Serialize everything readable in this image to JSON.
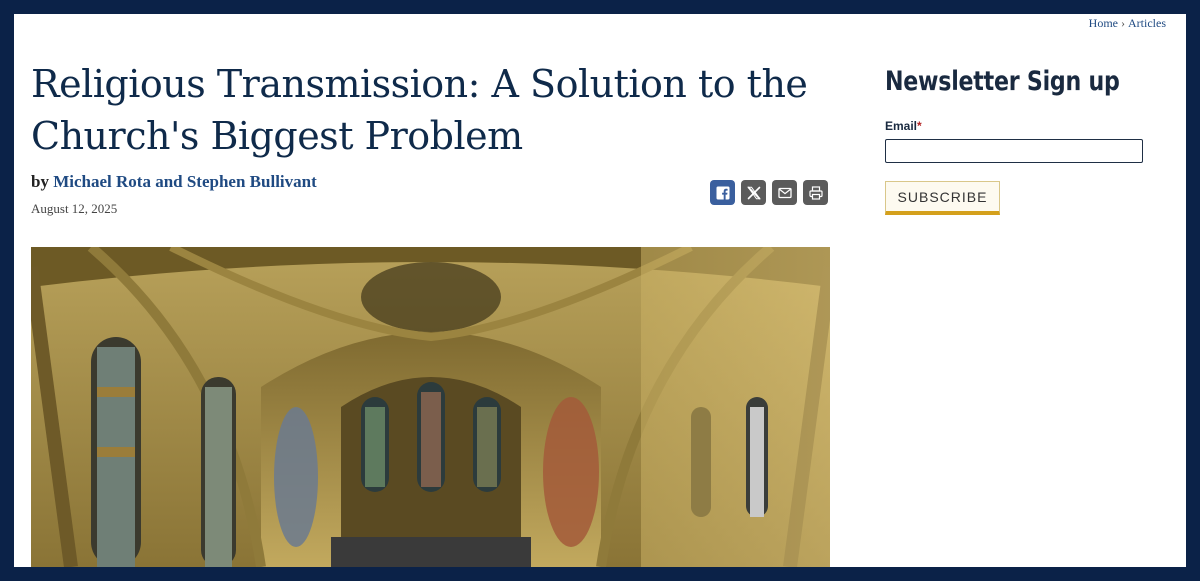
{
  "breadcrumb": {
    "home": "Home",
    "separator": "›",
    "current": "Articles"
  },
  "article": {
    "title": "Religious Transmission: A Solution to the Church's Biggest Problem",
    "by_prefix": "by",
    "authors": "Michael Rota and Stephen Bullivant",
    "date": "August 12, 2025"
  },
  "share": {
    "icons": [
      "facebook-icon",
      "x-icon",
      "email-icon",
      "print-icon"
    ]
  },
  "sidebar": {
    "title": "Newsletter Sign up",
    "email_label": "Email",
    "required_mark": "*",
    "email_value": "",
    "subscribe_label": "SUBSCRIBE"
  },
  "colors": {
    "frame": "#0b2248",
    "title": "#0f2a4a",
    "link": "#1f4a82",
    "facebook": "#3a5f9e",
    "share_gray": "#5b5b5b",
    "subscribe_accent": "#d4a01c"
  }
}
